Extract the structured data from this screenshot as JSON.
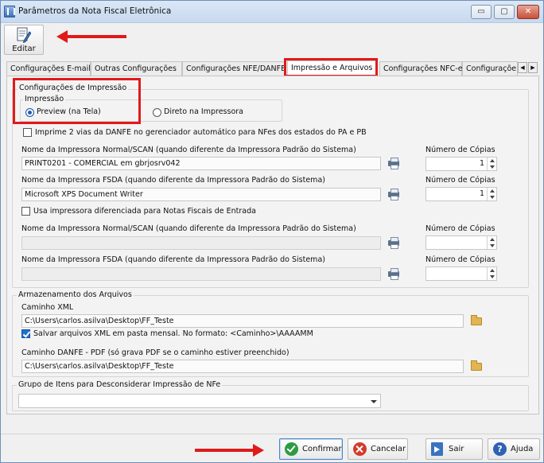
{
  "window": {
    "title": "Parâmetros da Nota Fiscal Eletrônica",
    "controls": {
      "minimize": "▭",
      "maximize": "▢",
      "close": "✕"
    }
  },
  "toolbar": {
    "edit_label": "Editar",
    "edit_icon": "edit-document-icon"
  },
  "tabs": [
    {
      "label": "Configurações E-mail"
    },
    {
      "label": "Outras Configurações"
    },
    {
      "label": "Configurações NFE/DANFE"
    },
    {
      "label": "Impressão e Arquivos",
      "active": true
    },
    {
      "label": "Configurações NFC-e"
    },
    {
      "label": "Configuraçõe"
    }
  ],
  "tab_scroll": {
    "left": "◀",
    "right": "▶"
  },
  "print_config": {
    "group_title": "Configurações de Impressão",
    "impressao_title": "Impressão",
    "radio_preview": "Preview (na Tela)",
    "radio_direct": "Direto na Impressora",
    "selected": "preview",
    "print2_label": "Imprime 2 vias da DANFE no gerenciador automático para NFes dos estados do PA e PB",
    "print2_checked": false,
    "normal_printer_label": "Nome da Impressora Normal/SCAN (quando diferente da Impressora Padrão do Sistema)",
    "normal_printer_value": "PRINT0201 - COMERCIAL em gbrjosrv042",
    "copies_label": "Número de Cópias",
    "normal_copies": "1",
    "fsda_printer_label": "Nome da Impressora FSDA (quando diferente da Impressora Padrão do Sistema)",
    "fsda_printer_value": "Microsoft XPS Document Writer",
    "fsda_copies": "1",
    "entrada_label": "Usa impressora diferenciada para Notas Fiscais de Entrada",
    "entrada_checked": false,
    "entrada_normal_label": "Nome da Impressora Normal/SCAN (quando diferente da Impressora Padrão do Sistema)",
    "entrada_normal_value": "",
    "entrada_normal_copies": "",
    "entrada_fsda_label": "Nome da Impressora FSDA (quando diferente da Impressora Padrão do Sistema)",
    "entrada_fsda_value": "",
    "entrada_fsda_copies": ""
  },
  "storage": {
    "group_title": "Armazenamento dos Arquivos",
    "xml_label": "Caminho XML",
    "xml_path": "C:\\Users\\carlos.asilva\\Desktop\\FF_Teste",
    "monthly_label": "Salvar arquivos XML em pasta mensal. No formato: <Caminho>\\AAAAMM",
    "monthly_checked": true,
    "pdf_label": "Caminho DANFE - PDF (só grava PDF se o caminho estiver preenchido)",
    "pdf_path": "C:\\Users\\carlos.asilva\\Desktop\\FF_Teste"
  },
  "group_items": {
    "title": "Grupo de Itens para Desconsiderar Impressão de NFe",
    "selected": ""
  },
  "buttons": {
    "confirm": "Confirmar",
    "cancel": "Cancelar",
    "exit": "Sair",
    "help": "Ajuda",
    "help_glyph": "?"
  },
  "colors": {
    "annotation": "#e01a1a",
    "accent": "#1f5fb8"
  }
}
